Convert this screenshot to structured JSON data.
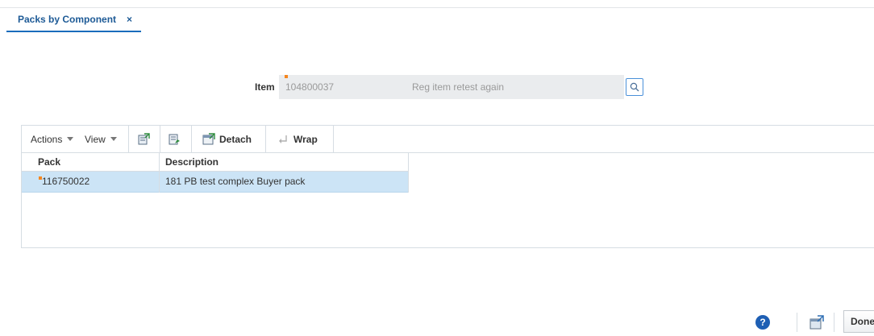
{
  "tab": {
    "title": "Packs by Component",
    "close_glyph": "×"
  },
  "item": {
    "label": "Item",
    "value": "104800037",
    "description": "Reg item retest again",
    "search_icon": "search-icon"
  },
  "toolbar": {
    "actions_label": "Actions",
    "view_label": "View",
    "detach_label": "Detach",
    "wrap_label": "Wrap"
  },
  "table": {
    "headers": {
      "pack": "Pack",
      "description": "Description"
    },
    "rows": [
      {
        "pack": "116750022",
        "description": "181 PB test complex Buyer pack"
      }
    ]
  },
  "footer": {
    "help_glyph": "?",
    "done_label": "Done"
  },
  "colors": {
    "accent": "#1a6dbc",
    "selected_row": "#cce4f6",
    "required": "#f5861f"
  }
}
